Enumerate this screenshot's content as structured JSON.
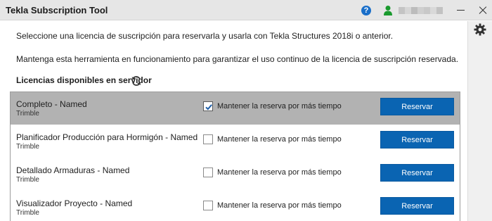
{
  "window": {
    "title": "Tekla Subscription Tool",
    "help_icon": "?",
    "icons": [
      "help-icon",
      "user-icon",
      "minimize-icon",
      "close-icon",
      "gear-icon",
      "refresh-icon"
    ]
  },
  "info": {
    "line1": "Seleccione una licencia de suscripción para reservarla y usarla con Tekla Structures 2018i o anterior.",
    "line2": "Mantenga esta herramienta en funcionamiento para garantizar el uso continuo de la licencia de suscripción reservada."
  },
  "section": {
    "label": "Licencias disponibles en servidor"
  },
  "licenses": [
    {
      "name": "Completo - Named",
      "vendor": "Trimble",
      "keep_label": "Mantener la reserva por más tiempo",
      "keep_checked": true,
      "selected": true,
      "button": "Reservar"
    },
    {
      "name": "Planificador Producción para Hormigón - Named",
      "vendor": "Trimble",
      "keep_label": "Mantener la reserva por más tiempo",
      "keep_checked": false,
      "selected": false,
      "button": "Reservar"
    },
    {
      "name": "Detallado Armaduras - Named",
      "vendor": "Trimble",
      "keep_label": "Mantener la reserva por más tiempo",
      "keep_checked": false,
      "selected": false,
      "button": "Reservar"
    },
    {
      "name": "Visualizador Proyecto - Named",
      "vendor": "Trimble",
      "keep_label": "Mantener la reserva por más tiempo",
      "keep_checked": false,
      "selected": false,
      "button": "Reservar"
    }
  ],
  "colors": {
    "accent": "#0a64b2",
    "selected_row": "#b2b2b2",
    "titlebar": "#e6e6e6",
    "user_icon": "#1a9a2e"
  }
}
